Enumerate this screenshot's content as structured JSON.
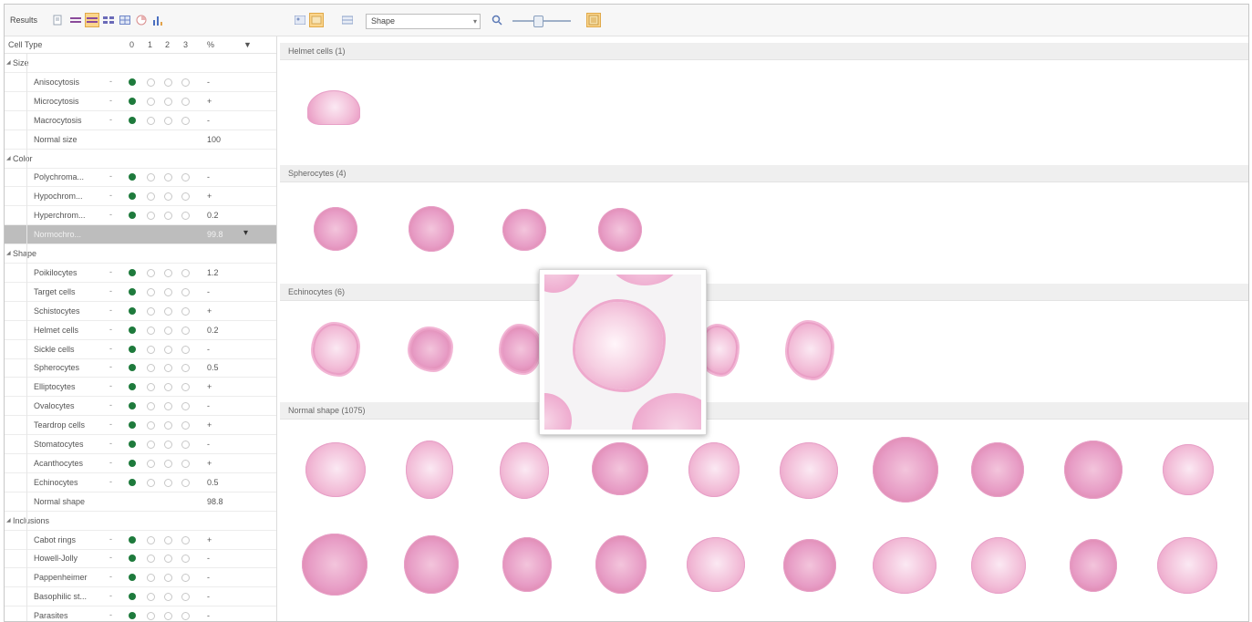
{
  "toolbar": {
    "results_label": "Results",
    "view_dropdown": {
      "selected": "Shape"
    },
    "icons": [
      "document-icon",
      "list-icon",
      "grid-icon",
      "multi-grid-icon",
      "table-icon",
      "pie-icon",
      "bar-chart-icon",
      "gallery-icon",
      "highlight-icon",
      "stack-icon",
      "zoom-out-icon",
      "zoom-in-icon"
    ]
  },
  "grid": {
    "headers": {
      "cell_type": "Cell Type",
      "c0": "0",
      "c1": "1",
      "c2": "2",
      "c3": "3",
      "pct": "%",
      "pin": "▼"
    },
    "groups": [
      {
        "name": "Size",
        "rows": [
          {
            "name": "Anisocytosis",
            "dash": "-",
            "pct": "-"
          },
          {
            "name": "Microcytosis",
            "dash": "-",
            "pct": "+"
          },
          {
            "name": "Macrocytosis",
            "dash": "-",
            "pct": "-"
          },
          {
            "name": "Normal size",
            "pct": "100",
            "plain": true
          }
        ]
      },
      {
        "name": "Color",
        "rows": [
          {
            "name": "Polychroma...",
            "dash": "-",
            "pct": "-"
          },
          {
            "name": "Hypochrom...",
            "dash": "-",
            "pct": "+"
          },
          {
            "name": "Hyperchrom...",
            "dash": "-",
            "pct": "0.2"
          },
          {
            "name": "Normochro...",
            "pct": "99.8",
            "plain": true,
            "selected": true
          }
        ]
      },
      {
        "name": "Shape",
        "rows": [
          {
            "name": "Poikilocytes",
            "dash": "-",
            "pct": "1.2"
          },
          {
            "name": "Target cells",
            "dash": "-",
            "pct": "-"
          },
          {
            "name": "Schistocytes",
            "dash": "-",
            "pct": "+"
          },
          {
            "name": "Helmet cells",
            "dash": "-",
            "pct": "0.2"
          },
          {
            "name": "Sickle cells",
            "dash": "-",
            "pct": "-"
          },
          {
            "name": "Spherocytes",
            "dash": "-",
            "pct": "0.5"
          },
          {
            "name": "Elliptocytes",
            "dash": "-",
            "pct": "+"
          },
          {
            "name": "Ovalocytes",
            "dash": "-",
            "pct": "-"
          },
          {
            "name": "Teardrop cells",
            "dash": "-",
            "pct": "+"
          },
          {
            "name": "Stomatocytes",
            "dash": "-",
            "pct": "-"
          },
          {
            "name": "Acanthocytes",
            "dash": "-",
            "pct": "+"
          },
          {
            "name": "Echinocytes",
            "dash": "-",
            "pct": "0.5"
          },
          {
            "name": "Normal shape",
            "pct": "98.8",
            "plain": true
          }
        ]
      },
      {
        "name": "Inclusions",
        "rows": [
          {
            "name": "Cabot rings",
            "dash": "-",
            "pct": "+"
          },
          {
            "name": "Howell-Jolly",
            "dash": "-",
            "pct": "-"
          },
          {
            "name": "Pappenheimer",
            "dash": "-",
            "pct": "-"
          },
          {
            "name": "Basophilic st...",
            "dash": "-",
            "pct": "-"
          },
          {
            "name": "Parasites",
            "dash": "-",
            "pct": "-"
          }
        ]
      }
    ]
  },
  "gallery": {
    "sections": [
      {
        "title": "Helmet cells (1)"
      },
      {
        "title": "Spherocytes (4)"
      },
      {
        "title": "Echinocytes (6)"
      },
      {
        "title": "Normal shape (1075)"
      }
    ]
  },
  "colors": {
    "accent_toolbar_active": "#fbd58c",
    "dot_filled": "#1e7a3c",
    "cell_pink": "#f2bcd7"
  }
}
